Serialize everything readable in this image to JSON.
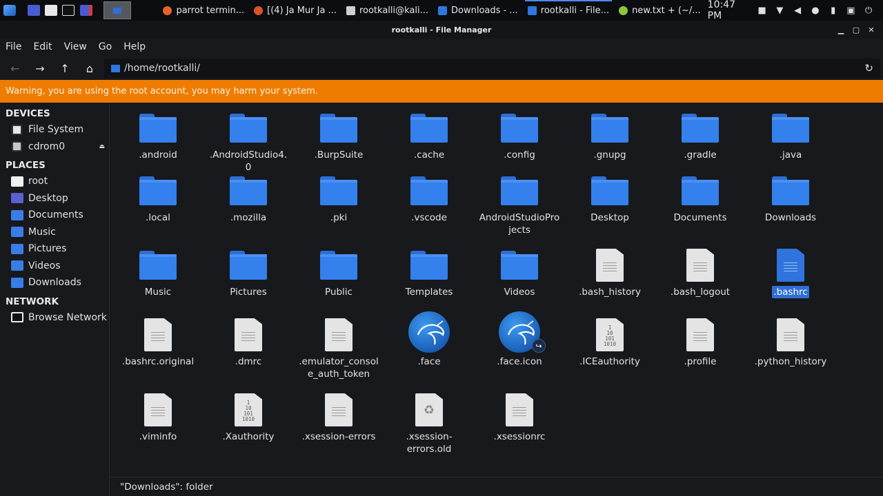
{
  "taskbar": {
    "tasks": [
      {
        "label": "parrot termin...",
        "color": "#e8622c"
      },
      {
        "label": "[(4) Ja Mur Ja ...",
        "color": "#d9522a"
      },
      {
        "label": "rootkalli@kali...",
        "color": "#cfcfcf"
      },
      {
        "label": "Downloads - ...",
        "color": "#2f76df"
      },
      {
        "label": "rootkalli - File...",
        "color": "#2f76df",
        "active": true
      },
      {
        "label": "new.txt + (~/...",
        "color": "#8cc63f"
      }
    ],
    "clock": "10:47 PM"
  },
  "window": {
    "title": "rootkalli - File Manager"
  },
  "menu": {
    "file": "File",
    "edit": "Edit",
    "view": "View",
    "go": "Go",
    "help": "Help"
  },
  "toolbar": {
    "path": "/home/rootkalli/"
  },
  "warning": "Warning, you are using the root account, you may harm your system.",
  "sidebar": {
    "devices_header": "DEVICES",
    "places_header": "PLACES",
    "network_header": "NETWORK",
    "devices": [
      {
        "label": "File System",
        "icon": "drive-icon"
      },
      {
        "label": "cdrom0",
        "icon": "disc-icon"
      }
    ],
    "places": [
      {
        "label": "root",
        "icon": "home-folder-icon"
      },
      {
        "label": "Desktop",
        "icon": "desktop-folder-icon"
      },
      {
        "label": "Documents",
        "icon": "documents-folder-icon"
      },
      {
        "label": "Music",
        "icon": "music-folder-icon"
      },
      {
        "label": "Pictures",
        "icon": "pictures-folder-icon"
      },
      {
        "label": "Videos",
        "icon": "videos-folder-icon"
      },
      {
        "label": "Downloads",
        "icon": "downloads-folder-icon"
      }
    ],
    "network": [
      {
        "label": "Browse Network",
        "icon": "network-icon"
      }
    ]
  },
  "files": [
    {
      "name": ".android",
      "type": "folder"
    },
    {
      "name": ".AndroidStudio4.0",
      "type": "folder"
    },
    {
      "name": ".BurpSuite",
      "type": "folder"
    },
    {
      "name": ".cache",
      "type": "folder"
    },
    {
      "name": ".config",
      "type": "folder"
    },
    {
      "name": ".gnupg",
      "type": "folder"
    },
    {
      "name": ".gradle",
      "type": "folder"
    },
    {
      "name": ".java",
      "type": "folder"
    },
    {
      "name": ".local",
      "type": "folder"
    },
    {
      "name": ".mozilla",
      "type": "folder"
    },
    {
      "name": ".pki",
      "type": "folder"
    },
    {
      "name": ".vscode",
      "type": "folder"
    },
    {
      "name": "AndroidStudioProj​ects",
      "type": "folder"
    },
    {
      "name": "Desktop",
      "type": "folder"
    },
    {
      "name": "Documents",
      "type": "folder"
    },
    {
      "name": "Downloads",
      "type": "folder"
    },
    {
      "name": "Music",
      "type": "folder"
    },
    {
      "name": "Pictures",
      "type": "folder"
    },
    {
      "name": "Public",
      "type": "folder"
    },
    {
      "name": "Templates",
      "type": "folder"
    },
    {
      "name": "Videos",
      "type": "folder"
    },
    {
      "name": ".bash_history",
      "type": "text"
    },
    {
      "name": ".bash_logout",
      "type": "text"
    },
    {
      "name": ".bashrc",
      "type": "text",
      "selected": true
    },
    {
      "name": ".bashrc.original",
      "type": "text"
    },
    {
      "name": ".dmrc",
      "type": "text"
    },
    {
      "name": ".emulator_console​_auth_token",
      "type": "text"
    },
    {
      "name": ".face",
      "type": "image"
    },
    {
      "name": ".face.icon",
      "type": "link"
    },
    {
      "name": ".ICEauthority",
      "type": "binary"
    },
    {
      "name": ".profile",
      "type": "text"
    },
    {
      "name": ".python_history",
      "type": "text"
    },
    {
      "name": ".viminfo",
      "type": "text"
    },
    {
      "name": ".Xauthority",
      "type": "binary"
    },
    {
      "name": ".xsession-errors",
      "type": "text"
    },
    {
      "name": ".xsession-​errors.old",
      "type": "recycle"
    },
    {
      "name": ".xsessionrc",
      "type": "text"
    }
  ],
  "status": "\"Downloads\": folder",
  "colors": {
    "accent": "#3480ec",
    "warning": "#ee7c00",
    "background": "#17191d"
  }
}
